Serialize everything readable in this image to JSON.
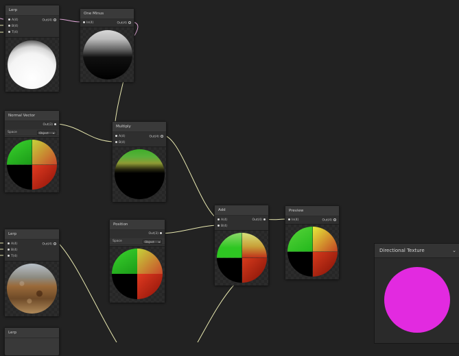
{
  "nodes": {
    "lerp_top": {
      "title": "Lerp",
      "inputs": [
        "A(4)",
        "B(4)",
        "T(4)"
      ],
      "output": "Out(4)"
    },
    "one_minus": {
      "title": "One Minus",
      "inputs": [
        "In(4)"
      ],
      "output": "Out(4)"
    },
    "normal_vector": {
      "title": "Normal Vector",
      "output": "Out(3)",
      "space_label": "Space",
      "space_value": "Object"
    },
    "multiply": {
      "title": "Multiply",
      "inputs": [
        "A(4)",
        "B(4)"
      ],
      "output": "Out(4)"
    },
    "position": {
      "title": "Position",
      "output": "Out(3)",
      "space_label": "Space",
      "space_value": "Object"
    },
    "add": {
      "title": "Add",
      "inputs": [
        "A(4)",
        "B(4)"
      ],
      "output": "Out(4)"
    },
    "preview": {
      "title": "Preview",
      "inputs": [
        "In(4)"
      ],
      "output": "Out(4)"
    },
    "lerp_mid": {
      "title": "Lerp",
      "inputs": [
        "A(4)",
        "B(4)",
        "T(4)"
      ],
      "output": "Out(4)"
    },
    "lerp_bottom": {
      "title": "Lerp"
    }
  },
  "main_preview": {
    "title": "Directional Texture",
    "sphere_color": "#e22ae0"
  },
  "colors": {
    "wire": "#e8e8b0",
    "wire_pink": "#e0a8d8"
  }
}
